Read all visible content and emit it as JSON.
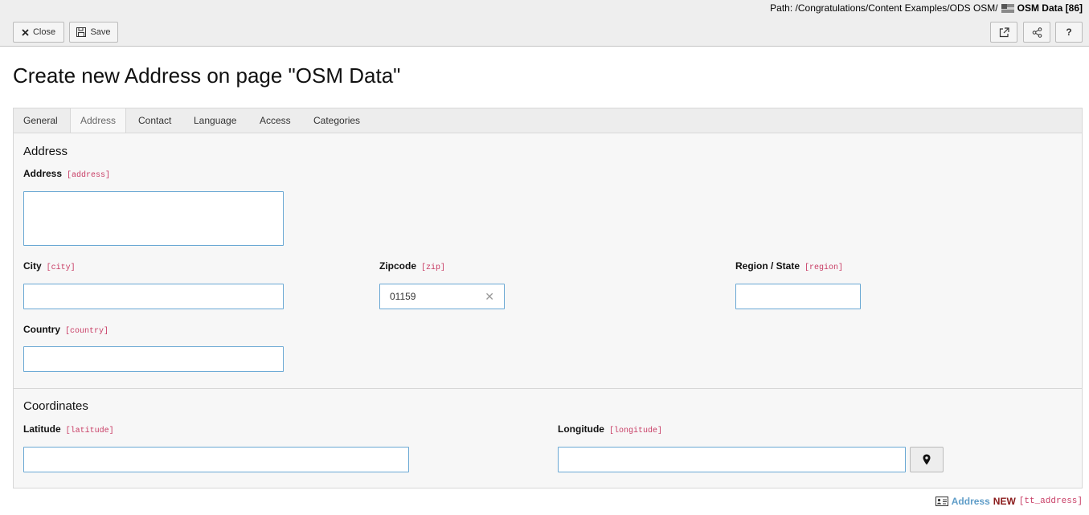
{
  "header": {
    "path_label": "Path: /Congratulations/Content Examples/ODS OSM/",
    "page_title": "OSM Data [86]",
    "close_label": "Close",
    "save_label": "Save",
    "help_label": "?"
  },
  "title": "Create new Address on page \"OSM Data\"",
  "tabs": [
    {
      "label": "General",
      "active": false
    },
    {
      "label": "Address",
      "active": true
    },
    {
      "label": "Contact",
      "active": false
    },
    {
      "label": "Language",
      "active": false
    },
    {
      "label": "Access",
      "active": false
    },
    {
      "label": "Categories",
      "active": false
    }
  ],
  "sections": {
    "address": {
      "title": "Address",
      "fields": {
        "address": {
          "label": "Address",
          "code": "[address]",
          "value": ""
        },
        "city": {
          "label": "City",
          "code": "[city]",
          "value": ""
        },
        "zip": {
          "label": "Zipcode",
          "code": "[zip]",
          "value": "01159"
        },
        "region": {
          "label": "Region / State",
          "code": "[region]",
          "value": ""
        },
        "country": {
          "label": "Country",
          "code": "[country]",
          "value": ""
        }
      }
    },
    "coordinates": {
      "title": "Coordinates",
      "fields": {
        "latitude": {
          "label": "Latitude",
          "code": "[latitude]",
          "value": ""
        },
        "longitude": {
          "label": "Longitude",
          "code": "[longitude]",
          "value": ""
        }
      }
    }
  },
  "footer": {
    "table_name": "Address",
    "status": "NEW",
    "table_code": "[tt_address]"
  },
  "icons": [
    "close-icon",
    "save-icon",
    "open-new-window-icon",
    "share-icon",
    "flag-icon",
    "clear-icon",
    "map-pin-icon",
    "record-icon"
  ],
  "colors": {
    "input_border": "#6aa8d4",
    "field_code": "#c83c64",
    "table_name": "#5f9dc8",
    "new_label": "#8a1a1a"
  }
}
